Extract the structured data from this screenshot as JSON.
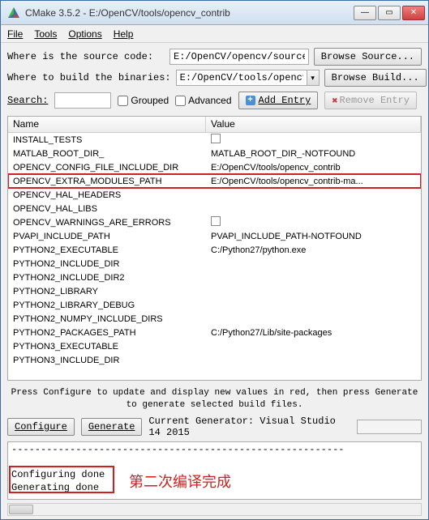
{
  "titlebar": {
    "app": "CMake 3.5.2",
    "path": "E:/OpenCV/tools/opencv_contrib"
  },
  "menu": {
    "file": "File",
    "tools": "Tools",
    "options": "Options",
    "help": "Help"
  },
  "labels": {
    "source": "Where is the source code:",
    "build": "Where to build the binaries:",
    "browse_source": "Browse Source...",
    "browse_build": "Browse Build...",
    "search": "Search:",
    "grouped": "Grouped",
    "advanced": "Advanced",
    "add_entry": "Add Entry",
    "remove_entry": "Remove Entry",
    "col_name": "Name",
    "col_value": "Value",
    "hint": "Press Configure to update and display new values in red, then press Generate to\ngenerate selected build files.",
    "configure": "Configure",
    "generate": "Generate",
    "generator": "Current Generator: Visual Studio 14 2015"
  },
  "paths": {
    "source": "E:/OpenCV/opencv/sources",
    "build": "E:/OpenCV/tools/opencv_contrib"
  },
  "rows": [
    {
      "name": "INSTALL_TESTS",
      "value": "",
      "chk": true
    },
    {
      "name": "MATLAB_ROOT_DIR_",
      "value": "MATLAB_ROOT_DIR_-NOTFOUND"
    },
    {
      "name": "OPENCV_CONFIG_FILE_INCLUDE_DIR",
      "value": "E:/OpenCV/tools/opencv_contrib"
    },
    {
      "name": "OPENCV_EXTRA_MODULES_PATH",
      "value": "E:/OpenCV/tools/opencv_contrib-ma...",
      "hl": true
    },
    {
      "name": "OPENCV_HAL_HEADERS",
      "value": ""
    },
    {
      "name": "OPENCV_HAL_LIBS",
      "value": ""
    },
    {
      "name": "OPENCV_WARNINGS_ARE_ERRORS",
      "value": "",
      "chk": true
    },
    {
      "name": "PVAPI_INCLUDE_PATH",
      "value": "PVAPI_INCLUDE_PATH-NOTFOUND"
    },
    {
      "name": "PYTHON2_EXECUTABLE",
      "value": "C:/Python27/python.exe"
    },
    {
      "name": "PYTHON2_INCLUDE_DIR",
      "value": ""
    },
    {
      "name": "PYTHON2_INCLUDE_DIR2",
      "value": ""
    },
    {
      "name": "PYTHON2_LIBRARY",
      "value": ""
    },
    {
      "name": "PYTHON2_LIBRARY_DEBUG",
      "value": ""
    },
    {
      "name": "PYTHON2_NUMPY_INCLUDE_DIRS",
      "value": ""
    },
    {
      "name": "PYTHON2_PACKAGES_PATH",
      "value": "C:/Python27/Lib/site-packages"
    },
    {
      "name": "PYTHON3_EXECUTABLE",
      "value": ""
    },
    {
      "name": "PYTHON3_INCLUDE_DIR",
      "value": ""
    }
  ],
  "output": "---------------------------------------------------------\n\nConfiguring done\nGenerating done",
  "annotation": "第二次编译完成"
}
